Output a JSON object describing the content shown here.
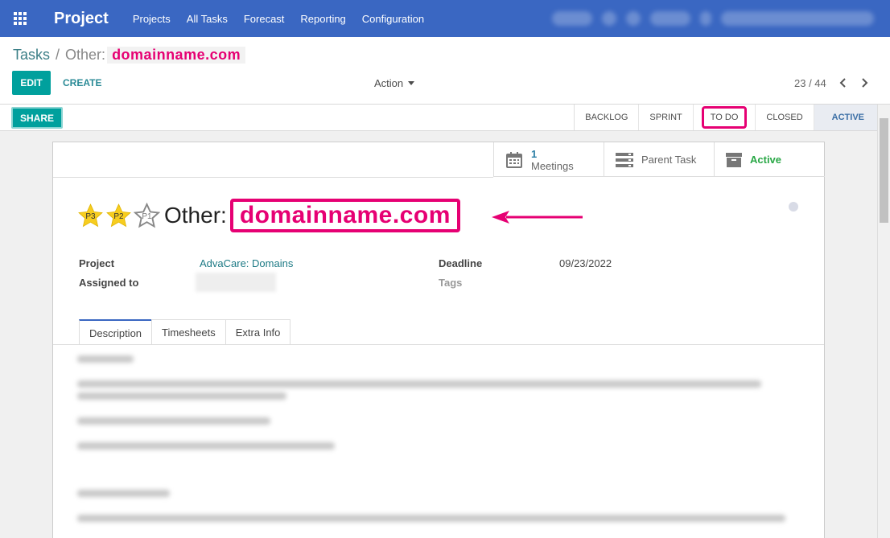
{
  "navbar": {
    "app_title": "Project",
    "menu": [
      "Projects",
      "All Tasks",
      "Forecast",
      "Reporting",
      "Configuration"
    ]
  },
  "breadcrumb": {
    "parent": "Tasks",
    "separator": "/",
    "current_prefix": "Other:",
    "current_domain": "domainname.com"
  },
  "toolbar": {
    "edit_label": "EDIT",
    "create_label": "CREATE",
    "action_label": "Action"
  },
  "pager": {
    "value": "23 / 44"
  },
  "statusbar": {
    "share_label": "SHARE",
    "stages": [
      "BACKLOG",
      "SPRINT",
      "TO DO",
      "CLOSED",
      "ACTIVE"
    ],
    "highlighted_stage": "TO DO",
    "current_stage": "ACTIVE"
  },
  "button_box": {
    "meetings_count": "1",
    "meetings_label": "Meetings",
    "parent_task_label": "Parent Task",
    "active_label": "Active"
  },
  "title": {
    "stars": [
      "P3",
      "P2",
      "P1"
    ],
    "prefix": "Other:",
    "domain": "domainname.com"
  },
  "fields": {
    "project_label": "Project",
    "project_value": "AdvaCare: Domains",
    "assigned_label": "Assigned to",
    "deadline_label": "Deadline",
    "deadline_value": "09/23/2022",
    "tags_label": "Tags"
  },
  "tabs": [
    "Description",
    "Timesheets",
    "Extra Info"
  ],
  "colors": {
    "navbar": "#3a67c2",
    "primary_button": "#00a09d",
    "highlight": "#e60073",
    "star": "#f7cd1f"
  }
}
